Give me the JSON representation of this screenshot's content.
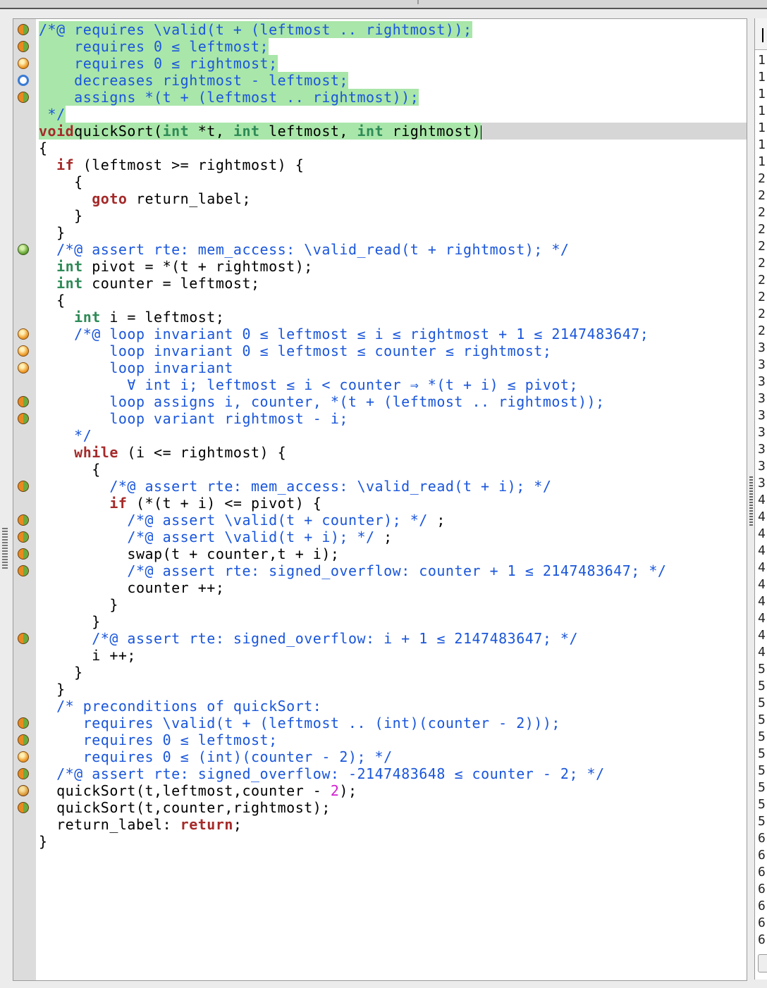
{
  "editor": {
    "lines": [
      {
        "status": "partial",
        "hl": true,
        "segs": [
          [
            "ac",
            "/*@ requires \\valid(t + (leftmost .. rightmost));"
          ]
        ]
      },
      {
        "status": "partial",
        "hl": true,
        "segs": [
          [
            "ac",
            "    requires 0 ≤ leftmost;"
          ]
        ]
      },
      {
        "status": "unknown",
        "hl": true,
        "segs": [
          [
            "ac",
            "    requires 0 ≤ rightmost;"
          ]
        ]
      },
      {
        "status": "none",
        "hl": true,
        "segs": [
          [
            "ac",
            "    decreases rightmost - leftmost;"
          ]
        ]
      },
      {
        "status": "partial",
        "hl": true,
        "segs": [
          [
            "ac",
            "    assigns *(t + (leftmost .. rightmost));"
          ]
        ]
      },
      {
        "status": "",
        "hl": true,
        "segs": [
          [
            "ac",
            " */"
          ]
        ]
      },
      {
        "status": "",
        "hl": true,
        "cur": true,
        "segs": [
          [
            "kw",
            "void"
          ],
          [
            "",
            "quickSort"
          ],
          [
            "",
            "("
          ],
          [
            "ty",
            "int"
          ],
          [
            "",
            " *t, "
          ],
          [
            "ty",
            "int"
          ],
          [
            "",
            " leftmost, "
          ],
          [
            "ty",
            "int"
          ],
          [
            "",
            " rightmost)"
          ]
        ]
      },
      {
        "status": "",
        "segs": [
          [
            "",
            "{"
          ]
        ]
      },
      {
        "status": "",
        "segs": [
          [
            "",
            "  "
          ],
          [
            "kw",
            "if"
          ],
          [
            "",
            " (leftmost >= rightmost) {"
          ]
        ]
      },
      {
        "status": "",
        "segs": [
          [
            "",
            "    {"
          ]
        ]
      },
      {
        "status": "",
        "segs": [
          [
            "",
            "      "
          ],
          [
            "kw",
            "goto"
          ],
          [
            "",
            " return_label;"
          ]
        ]
      },
      {
        "status": "",
        "segs": [
          [
            "",
            "    }"
          ]
        ]
      },
      {
        "status": "",
        "segs": [
          [
            "",
            "  }"
          ]
        ]
      },
      {
        "status": "valid",
        "segs": [
          [
            "",
            "  "
          ],
          [
            "ac",
            "/*@ assert rte: mem_access: \\valid_read(t + rightmost); */"
          ]
        ]
      },
      {
        "status": "",
        "segs": [
          [
            "",
            "  "
          ],
          [
            "ty",
            "int"
          ],
          [
            "",
            " pivot = *(t + rightmost);"
          ]
        ]
      },
      {
        "status": "",
        "segs": [
          [
            "",
            "  "
          ],
          [
            "ty",
            "int"
          ],
          [
            "",
            " counter = leftmost;"
          ]
        ]
      },
      {
        "status": "",
        "segs": [
          [
            "",
            "  {"
          ]
        ]
      },
      {
        "status": "",
        "segs": [
          [
            "",
            "    "
          ],
          [
            "ty",
            "int"
          ],
          [
            "",
            " i = leftmost;"
          ]
        ]
      },
      {
        "status": "unknown",
        "segs": [
          [
            "",
            "    "
          ],
          [
            "ac",
            "/*@ loop invariant 0 ≤ leftmost ≤ i ≤ rightmost + 1 ≤ 2147483647;"
          ]
        ]
      },
      {
        "status": "unknown",
        "segs": [
          [
            "ac",
            "        loop invariant 0 ≤ leftmost ≤ counter ≤ rightmost;"
          ]
        ]
      },
      {
        "status": "unknown",
        "segs": [
          [
            "ac",
            "        loop invariant"
          ]
        ]
      },
      {
        "status": "",
        "segs": [
          [
            "ac",
            "          ∀ int i; leftmost ≤ i < counter ⇒ *(t + i) ≤ pivot;"
          ]
        ]
      },
      {
        "status": "partial",
        "segs": [
          [
            "ac",
            "        loop assigns i, counter, *(t + (leftmost .. rightmost));"
          ]
        ]
      },
      {
        "status": "partial",
        "segs": [
          [
            "ac",
            "        loop variant rightmost - i;"
          ]
        ]
      },
      {
        "status": "",
        "segs": [
          [
            "ac",
            "    */"
          ]
        ]
      },
      {
        "status": "",
        "segs": [
          [
            "",
            "    "
          ],
          [
            "kw",
            "while"
          ],
          [
            "",
            " (i <= rightmost) {"
          ]
        ]
      },
      {
        "status": "",
        "segs": [
          [
            "",
            "      {"
          ]
        ]
      },
      {
        "status": "partial",
        "segs": [
          [
            "",
            "        "
          ],
          [
            "ac",
            "/*@ assert rte: mem_access: \\valid_read(t + i); */"
          ]
        ]
      },
      {
        "status": "",
        "segs": [
          [
            "",
            "        "
          ],
          [
            "kw",
            "if"
          ],
          [
            "",
            " (*(t + i) <= pivot) {"
          ]
        ]
      },
      {
        "status": "partial",
        "segs": [
          [
            "",
            "          "
          ],
          [
            "ac",
            "/*@ assert \\valid(t + counter); */"
          ],
          [
            "",
            " ;"
          ]
        ]
      },
      {
        "status": "partial",
        "segs": [
          [
            "",
            "          "
          ],
          [
            "ac",
            "/*@ assert \\valid(t + i); */"
          ],
          [
            "",
            " ;"
          ]
        ]
      },
      {
        "status": "partial",
        "segs": [
          [
            "",
            "          swap(t + counter,t + i);"
          ]
        ]
      },
      {
        "status": "partial",
        "segs": [
          [
            "",
            "          "
          ],
          [
            "ac",
            "/*@ assert rte: signed_overflow: counter + 1 ≤ 2147483647; */"
          ]
        ]
      },
      {
        "status": "",
        "segs": [
          [
            "",
            "          counter ++;"
          ]
        ]
      },
      {
        "status": "",
        "segs": [
          [
            "",
            "        }"
          ]
        ]
      },
      {
        "status": "",
        "segs": [
          [
            "",
            "      }"
          ]
        ]
      },
      {
        "status": "partial",
        "segs": [
          [
            "",
            "      "
          ],
          [
            "ac",
            "/*@ assert rte: signed_overflow: i + 1 ≤ 2147483647; */"
          ]
        ]
      },
      {
        "status": "",
        "segs": [
          [
            "",
            "      i ++;"
          ]
        ]
      },
      {
        "status": "",
        "segs": [
          [
            "",
            "    }"
          ]
        ]
      },
      {
        "status": "",
        "segs": [
          [
            "",
            "  }"
          ]
        ]
      },
      {
        "status": "",
        "segs": [
          [
            "",
            "  "
          ],
          [
            "ac",
            "/* preconditions of quickSort:"
          ]
        ]
      },
      {
        "status": "partial",
        "segs": [
          [
            "ac",
            "     requires \\valid(t + (leftmost .. (int)(counter - 2)));"
          ]
        ]
      },
      {
        "status": "partial",
        "segs": [
          [
            "ac",
            "     requires 0 ≤ leftmost;"
          ]
        ]
      },
      {
        "status": "unknown",
        "segs": [
          [
            "ac",
            "     requires 0 ≤ (int)(counter - 2); */"
          ]
        ]
      },
      {
        "status": "partial",
        "segs": [
          [
            "",
            "  "
          ],
          [
            "ac",
            "/*@ assert rte: signed_overflow: -2147483648 ≤ counter - 2; */"
          ]
        ]
      },
      {
        "status": "dead",
        "segs": [
          [
            "",
            "  quickSort(t,leftmost,counter - "
          ],
          [
            "num",
            "2"
          ],
          [
            "",
            ");"
          ]
        ]
      },
      {
        "status": "partial",
        "segs": [
          [
            "",
            "  quickSort(t,counter,rightmost);"
          ]
        ]
      },
      {
        "status": "",
        "segs": [
          [
            "",
            "  return_label: "
          ],
          [
            "kw",
            "return"
          ],
          [
            "",
            ";"
          ]
        ]
      },
      {
        "status": "",
        "segs": [
          [
            "",
            "}"
          ]
        ]
      }
    ]
  },
  "right_panel": {
    "line_numbers": [
      "1",
      "1",
      "1",
      "1",
      "1",
      "1",
      "1",
      "2",
      "2",
      "2",
      "2",
      "2",
      "2",
      "2",
      "2",
      "2",
      "2",
      "3",
      "3",
      "3",
      "3",
      "3",
      "3",
      "3",
      "3",
      "3",
      "4",
      "4",
      "4",
      "4",
      "4",
      "4",
      "4",
      "4",
      "4",
      "4",
      "5",
      "5",
      "5",
      "5",
      "5",
      "5",
      "5",
      "5",
      "5",
      "5",
      "6",
      "6",
      "6",
      "6",
      "6",
      "6",
      "6"
    ]
  },
  "colors": {
    "annotation": "#1a56db",
    "keyword": "#a52a2a",
    "type": "#2e8b57",
    "highlight": "#a9e6a9"
  }
}
